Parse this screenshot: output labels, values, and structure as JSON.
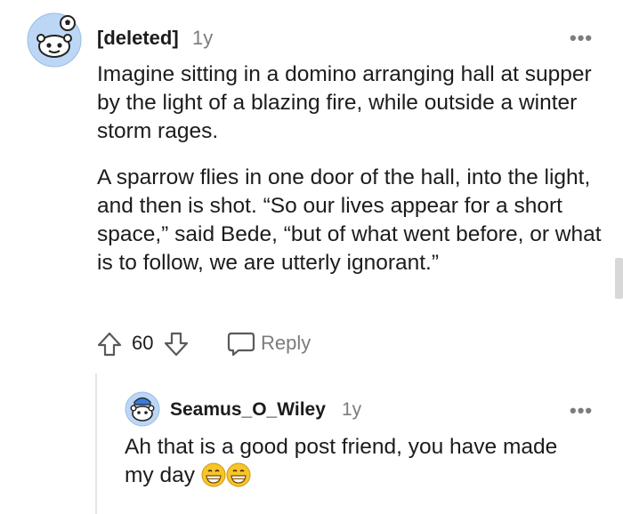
{
  "comment": {
    "author": "[deleted]",
    "age": "1y",
    "more_label": "•••",
    "paragraphs": [
      "Imagine sitting in a domino arranging hall at supper by the light of a blazing fire, while outside a winter storm rages.",
      "A sparrow flies in one door of the hall, into the light, and then is shot. “So our lives appear for a short space,” said Bede, “but of what went before, or what is to follow, we are utterly ignorant.”"
    ],
    "vote_count": "60",
    "reply_label": "Reply"
  },
  "reply": {
    "author": "Seamus_O_Wiley",
    "age": "1y",
    "more_label": "•••",
    "text": "Ah that is a good post friend, you have made my day"
  },
  "icons": {
    "upvote": "upvote-arrow-icon",
    "downvote": "downvote-arrow-icon",
    "reply": "speech-bubble-icon",
    "emoji": "grinning-face-icon"
  },
  "colors": {
    "avatar_bg": "#b7d3f3",
    "text": "#1c1c1c",
    "muted": "#7c7c7c"
  }
}
